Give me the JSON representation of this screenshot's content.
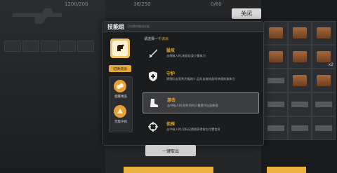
{
  "top": {
    "counter_left": "1200/200",
    "counter_mid": "36/250",
    "counter_right": "0/60",
    "close_label": "关闭"
  },
  "dialog": {
    "title": "技能组",
    "subtitle": "可切换技能组技能",
    "prompt_prefix": "请选择一个",
    "prompt_highlight": "流派",
    "switch_label": "切换流派",
    "current_skill_icon": "stomp-skill-icon",
    "mini_skills": [
      {
        "label": "烟雾掩盖",
        "icon": "smoke-icon"
      },
      {
        "label": "无敌冲锋",
        "icon": "charge-icon"
      }
    ],
    "skills": [
      {
        "name": "猛攻",
        "desc": "击倒敌人时,恢复自身少量体力",
        "icon": "sword-icon"
      },
      {
        "name": "守护",
        "desc": "周围队友受到大幅减少,且队友被扶起时快速恢复体力",
        "icon": "shield-cross-icon"
      },
      {
        "name": "游击",
        "desc": "击中敌人时,短时间内少量提升自身移速",
        "icon": "boot-icon"
      },
      {
        "name": "侦探",
        "desc": "击中敌人时,可标记透视获得较方位置信息",
        "icon": "target-icon"
      }
    ],
    "selected_index": 2
  },
  "extract_label": "一键取出",
  "colors": {
    "accent": "#e8a93a",
    "panel": "#1b1c1e"
  }
}
